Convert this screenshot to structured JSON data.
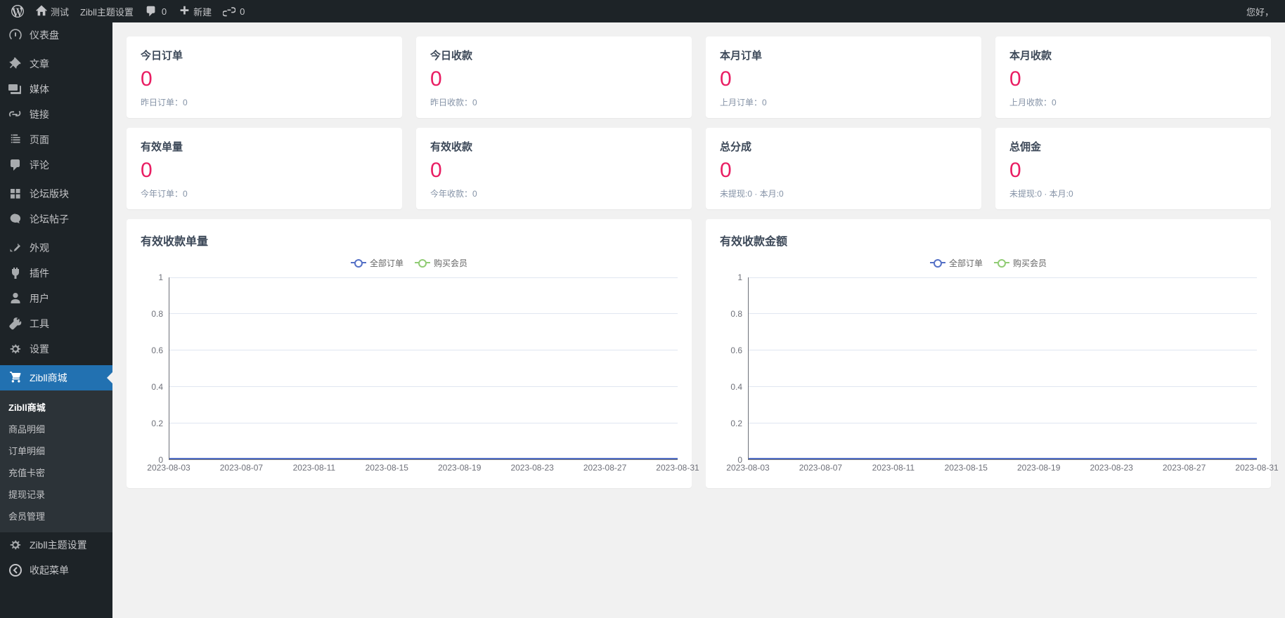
{
  "topbar": {
    "site": "测试",
    "theme_link": "Zibll主题设置",
    "comments_count": "0",
    "new": "新建",
    "link_count": "0",
    "greeting": "您好，"
  },
  "sidebar": {
    "items": [
      {
        "label": "仪表盘",
        "icon": "dashboard"
      },
      {
        "label": "文章",
        "icon": "pin"
      },
      {
        "label": "媒体",
        "icon": "media"
      },
      {
        "label": "链接",
        "icon": "link"
      },
      {
        "label": "页面",
        "icon": "page"
      },
      {
        "label": "评论",
        "icon": "comment"
      },
      {
        "label": "论坛版块",
        "icon": "forum"
      },
      {
        "label": "论坛帖子",
        "icon": "posts"
      },
      {
        "label": "外观",
        "icon": "appearance"
      },
      {
        "label": "插件",
        "icon": "plugin"
      },
      {
        "label": "用户",
        "icon": "user"
      },
      {
        "label": "工具",
        "icon": "tools"
      },
      {
        "label": "设置",
        "icon": "settings"
      }
    ],
    "zibll_shop": "Zibll商城",
    "submenu": [
      {
        "label": "Zibll商城",
        "current": true
      },
      {
        "label": "商品明细"
      },
      {
        "label": "订单明细"
      },
      {
        "label": "充值卡密"
      },
      {
        "label": "提现记录"
      },
      {
        "label": "会员管理"
      }
    ],
    "zibll_theme": "Zibll主题设置",
    "collapse": "收起菜单"
  },
  "stats": {
    "row1": [
      {
        "title": "今日订单",
        "value": "0",
        "sub": "昨日订单：0"
      },
      {
        "title": "今日收款",
        "value": "0",
        "sub": "昨日收款：0"
      },
      {
        "title": "本月订单",
        "value": "0",
        "sub": "上月订单：0"
      },
      {
        "title": "本月收款",
        "value": "0",
        "sub": "上月收款：0"
      }
    ],
    "row2": [
      {
        "title": "有效单量",
        "value": "0",
        "sub": "今年订单：0"
      },
      {
        "title": "有效收款",
        "value": "0",
        "sub": "今年收款：0"
      },
      {
        "title": "总分成",
        "value": "0",
        "sub": "未提现:0 · 本月:0"
      },
      {
        "title": "总佣金",
        "value": "0",
        "sub": "未提现:0 · 本月:0"
      }
    ]
  },
  "charts": [
    {
      "title": "有效收款单量",
      "legend": [
        "全部订单",
        "购买会员"
      ]
    },
    {
      "title": "有效收款金额",
      "legend": [
        "全部订单",
        "购买会员"
      ]
    }
  ],
  "chart_data": [
    {
      "type": "line",
      "title": "有效收款单量",
      "xlabel": "",
      "ylabel": "",
      "ylim": [
        0,
        1
      ],
      "y_ticks": [
        0,
        0.2,
        0.4,
        0.6,
        0.8,
        1
      ],
      "categories": [
        "2023-08-03",
        "2023-08-07",
        "2023-08-11",
        "2023-08-15",
        "2023-08-19",
        "2023-08-23",
        "2023-08-27",
        "2023-08-31"
      ],
      "series": [
        {
          "name": "全部订单",
          "values": [
            0,
            0,
            0,
            0,
            0,
            0,
            0,
            0
          ]
        },
        {
          "name": "购买会员",
          "values": [
            0,
            0,
            0,
            0,
            0,
            0,
            0,
            0
          ]
        }
      ]
    },
    {
      "type": "line",
      "title": "有效收款金额",
      "xlabel": "",
      "ylabel": "",
      "ylim": [
        0,
        1
      ],
      "y_ticks": [
        0,
        0.2,
        0.4,
        0.6,
        0.8,
        1
      ],
      "categories": [
        "2023-08-03",
        "2023-08-07",
        "2023-08-11",
        "2023-08-15",
        "2023-08-19",
        "2023-08-23",
        "2023-08-27",
        "2023-08-31"
      ],
      "series": [
        {
          "name": "全部订单",
          "values": [
            0,
            0,
            0,
            0,
            0,
            0,
            0,
            0
          ]
        },
        {
          "name": "购买会员",
          "values": [
            0,
            0,
            0,
            0,
            0,
            0,
            0,
            0
          ]
        }
      ]
    }
  ]
}
